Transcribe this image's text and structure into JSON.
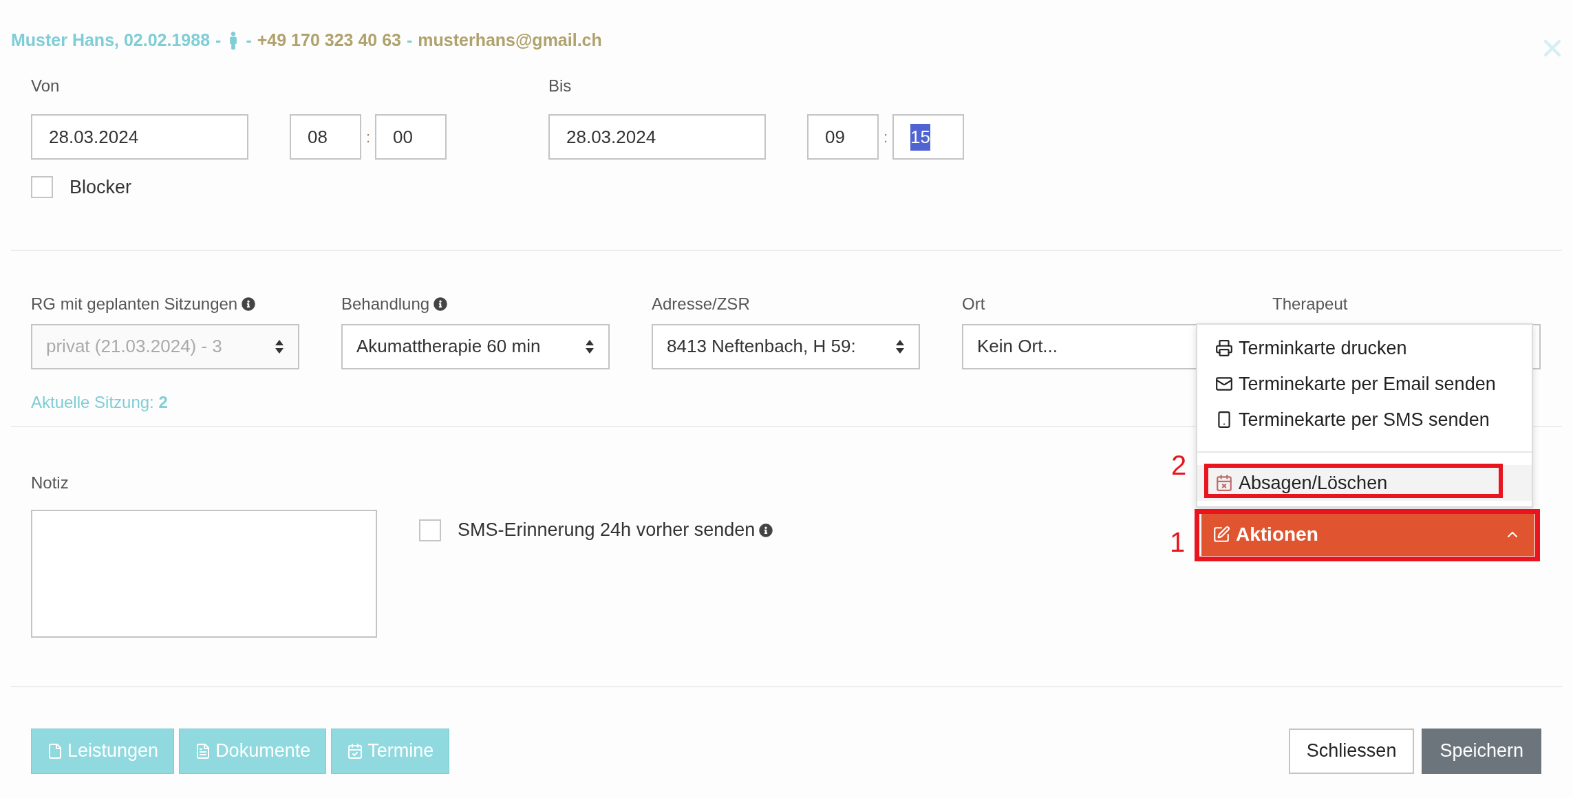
{
  "patient_line": [
    {
      "kind": "name",
      "text": "Muster Hans, 02.02.1988"
    },
    {
      "kind": "sep",
      "text": "-"
    },
    {
      "kind": "gender_icon"
    },
    {
      "kind": "sep",
      "text": "-"
    },
    {
      "kind": "contact",
      "text": "+49 170 323 40 63"
    },
    {
      "kind": "sep",
      "text": "-"
    },
    {
      "kind": "contact",
      "text": "musterhans@gmail.ch"
    }
  ],
  "time_range": [
    {
      "label": "Von",
      "date": "28.03.2024",
      "hour": "08",
      "separator": ":",
      "minute": "00",
      "minute_selected": false
    },
    {
      "label": "Bis",
      "date": "28.03.2024",
      "hour": "09",
      "separator": ":",
      "minute": "15",
      "minute_selected": true
    }
  ],
  "blocker": {
    "label": "Blocker",
    "checked": false
  },
  "selects": [
    {
      "label": "RG mit geplanten Sitzungen",
      "info": true,
      "value": "privat (21.03.2024) - 3",
      "disabled": true,
      "arrows": true
    },
    {
      "label": "Behandlung",
      "info": true,
      "value": "Akumattherapie 60 min",
      "disabled": false,
      "arrows": true
    },
    {
      "label": "Adresse/ZSR",
      "info": false,
      "value": "8413 Neftenbach, H 59:",
      "disabled": false,
      "arrows": true
    },
    {
      "label": "Ort",
      "info": false,
      "value": "Kein Ort...",
      "disabled": false,
      "arrows": false
    },
    {
      "label": "Therapeut"
    }
  ],
  "current_session": {
    "label": "Aktuelle Sitzung:",
    "value": "2"
  },
  "note": {
    "label": "Notiz"
  },
  "sms_reminder": {
    "label": "SMS-Erinnerung 24h vorher senden",
    "checked": false
  },
  "actions_menu": {
    "items": [
      {
        "kind": "print",
        "label": "Terminkarte drucken",
        "highlighted": false
      },
      {
        "kind": "email",
        "label": "Terminekarte per Email senden",
        "highlighted": false
      },
      {
        "kind": "sms",
        "label": "Terminekarte per SMS senden",
        "highlighted": false
      },
      {
        "kind": "divider"
      },
      {
        "kind": "cancel",
        "label": "Absagen/Löschen",
        "highlighted": true
      }
    ]
  },
  "actions_button": {
    "label": "Aktionen",
    "expanded": true
  },
  "annotations": [
    {
      "number": "2"
    },
    {
      "number": "1"
    }
  ],
  "left_buttons": [
    {
      "kind": "file",
      "label": "Leistungen"
    },
    {
      "kind": "doc",
      "label": "Dokumente"
    },
    {
      "kind": "calendar",
      "label": "Termine"
    }
  ],
  "right_buttons": [
    {
      "kind": "secondary",
      "label": "Schliessen"
    },
    {
      "kind": "primary",
      "label": "Speichern"
    }
  ]
}
